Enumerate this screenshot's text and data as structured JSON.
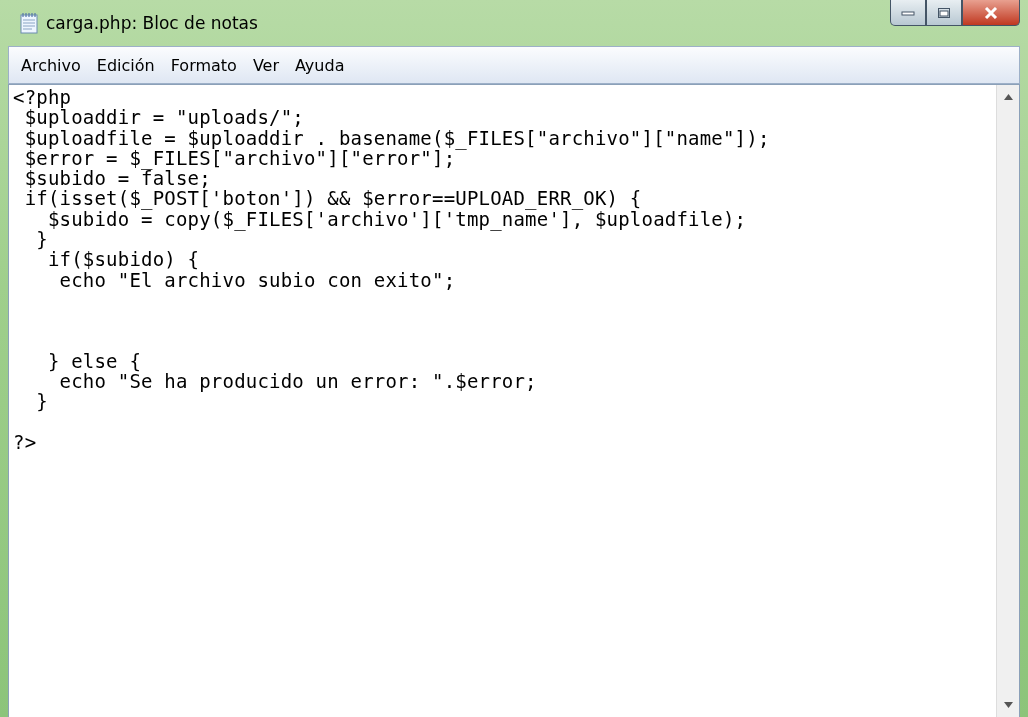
{
  "window": {
    "title": "carga.php: Bloc de notas"
  },
  "menu": [
    "Archivo",
    "Edición",
    "Formato",
    "Ver",
    "Ayuda"
  ],
  "editor": {
    "text": "<?php\n $uploaddir = \"uploads/\";\n $uploadfile = $uploaddir . basename($_FILES[\"archivo\"][\"name\"]);\n $error = $_FILES[\"archivo\"][\"error\"];\n $subido = false;\n if(isset($_POST['boton']) && $error==UPLOAD_ERR_OK) {\n   $subido = copy($_FILES['archivo']['tmp_name'], $uploadfile);\n  }\n   if($subido) {\n    echo \"El archivo subio con exito\";\n\n\n\n   } else {\n    echo \"Se ha producido un error: \".$error;\n  }\n\n?>"
  }
}
